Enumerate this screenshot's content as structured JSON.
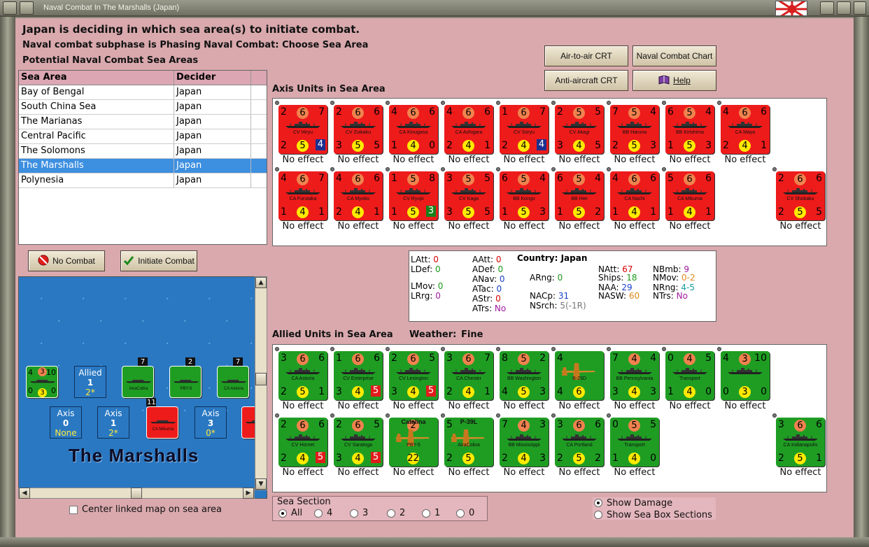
{
  "window": {
    "title": "Naval Combat In The Marshalls (Japan)"
  },
  "header": {
    "line1": "Japan is deciding in which sea area(s) to initiate combat.",
    "line2": "Naval combat subphase is Phasing Naval Combat: Choose Sea Area",
    "line3": "Potential Naval Combat Sea Areas"
  },
  "buttons": {
    "air_to_air": "Air-to-air CRT",
    "naval_chart": "Naval Combat Chart",
    "anti_aircraft": "Anti-aircraft CRT",
    "help": "Help",
    "no_combat": "No Combat",
    "initiate_combat": "Initiate Combat"
  },
  "sea_table": {
    "col_area": "Sea Area",
    "col_decider": "Decider",
    "rows": [
      {
        "area": "Bay of Bengal",
        "decider": "Japan"
      },
      {
        "area": "South China Sea",
        "decider": "Japan"
      },
      {
        "area": "The Marianas",
        "decider": "Japan"
      },
      {
        "area": "Central Pacific",
        "decider": "Japan"
      },
      {
        "area": "The Solomons",
        "decider": "Japan"
      },
      {
        "area": "The Marshalls",
        "decider": "Japan",
        "selected": true
      },
      {
        "area": "Polynesia",
        "decider": "Japan"
      }
    ]
  },
  "axis_section": {
    "title": "Axis Units in Sea Area",
    "status_text": "No effect",
    "units": [
      {
        "name": "CV Hiryu",
        "tl": "2",
        "tc": "6",
        "tr": "7",
        "bl": "2",
        "bc": "5",
        "br": "4",
        "br_box": "navy"
      },
      {
        "name": "CV Zuikaku",
        "tl": "2",
        "tc": "6",
        "tr": "6",
        "bl": "3",
        "bc": "5",
        "br": "5"
      },
      {
        "name": "CA Kinugasa",
        "tl": "4",
        "tc": "6",
        "tr": "6",
        "bl": "1",
        "bc": "4",
        "br": "0"
      },
      {
        "name": "CA Ashigara",
        "tl": "4",
        "tc": "6",
        "tr": "6",
        "bl": "2",
        "bc": "4",
        "br": "1"
      },
      {
        "name": "CV Soryu",
        "tl": "1",
        "tc": "6",
        "tr": "7",
        "bl": "2",
        "bc": "4",
        "br": "4",
        "br_box": "navy"
      },
      {
        "name": "CV Akagi",
        "tl": "2",
        "tc": "5",
        "tr": "5",
        "bl": "3",
        "bc": "4",
        "br": "5"
      },
      {
        "name": "BB Haruna",
        "tl": "7",
        "tc": "5",
        "tr": "4",
        "bl": "2",
        "bc": "5",
        "br": "3"
      },
      {
        "name": "BB Kirishima",
        "tl": "6",
        "tc": "5",
        "tr": "4",
        "bl": "1",
        "bc": "5",
        "br": "3"
      },
      {
        "name": "CA Maya",
        "tl": "4",
        "tc": "6",
        "tr": "6",
        "bl": "2",
        "bc": "4",
        "br": "1"
      },
      {
        "name": "CV Shokaku",
        "tl": "2",
        "tc": "6",
        "tr": "6",
        "bl": "2",
        "bc": "5",
        "br": "5"
      },
      {
        "name": "CA Furutaka",
        "tl": "4",
        "tc": "6",
        "tr": "7",
        "bl": "1",
        "bc": "4",
        "br": "1"
      },
      {
        "name": "CA Myoko",
        "tl": "4",
        "tc": "6",
        "tr": "6",
        "bl": "2",
        "bc": "4",
        "br": "1"
      },
      {
        "name": "CV Ryujo",
        "tl": "1",
        "tc": "5",
        "tr": "8",
        "bl": "1",
        "bc": "5",
        "br": "3",
        "br_box": "green"
      },
      {
        "name": "CV Kaga",
        "tl": "3",
        "tc": "5",
        "tr": "5",
        "bl": "3",
        "bc": "5",
        "br": "5"
      },
      {
        "name": "BB Kongo",
        "tl": "6",
        "tc": "5",
        "tr": "4",
        "bl": "1",
        "bc": "5",
        "br": "3"
      },
      {
        "name": "BB Hiei",
        "tl": "6",
        "tc": "5",
        "tr": "4",
        "bl": "1",
        "bc": "5",
        "br": "2"
      },
      {
        "name": "CA Nachi",
        "tl": "4",
        "tc": "6",
        "tr": "6",
        "bl": "1",
        "bc": "4",
        "br": "1"
      },
      {
        "name": "CA Mikuma",
        "tl": "5",
        "tc": "6",
        "tr": "6",
        "bl": "1",
        "bc": "4",
        "br": "1"
      }
    ]
  },
  "stats": {
    "country_label": "Country: Japan",
    "items": [
      {
        "k": "LAtt:",
        "v": "0",
        "col": "#d40000"
      },
      {
        "k": "LDef:",
        "v": "0",
        "col": "#1a9a1a"
      },
      {
        "k": "LMov:",
        "v": "0",
        "col": "#1a9a1a"
      },
      {
        "k": "LRrg:",
        "v": "0",
        "col": "#a01aa0"
      },
      {
        "k": "AAtt:",
        "v": "0",
        "col": "#d40000"
      },
      {
        "k": "ADef:",
        "v": "0",
        "col": "#1a9a1a"
      },
      {
        "k": "ANav:",
        "v": "0",
        "col": "#1a40c8"
      },
      {
        "k": "ATac:",
        "v": "0",
        "col": "#1a40c8"
      },
      {
        "k": "AStr:",
        "v": "0",
        "col": "#d40000"
      },
      {
        "k": "ATrs:",
        "v": "No",
        "col": "#a01aa0"
      },
      {
        "k": "ARng:",
        "v": "0",
        "col": "#1a9a1a"
      },
      {
        "k": "NACp:",
        "v": "31",
        "col": "#1a40c8"
      },
      {
        "k": "NSrch:",
        "v": "5(-1R)",
        "col": "#777"
      },
      {
        "k": "NAtt:",
        "v": "67",
        "col": "#d40000"
      },
      {
        "k": "Ships:",
        "v": "18",
        "col": "#1a9a1a"
      },
      {
        "k": "NAA:",
        "v": "29",
        "col": "#1a40c8"
      },
      {
        "k": "NASW:",
        "v": "60",
        "col": "#e08a1a"
      },
      {
        "k": "NBmb:",
        "v": "9",
        "col": "#a01aa0"
      },
      {
        "k": "NMov:",
        "v": "0-2",
        "col": "#e08a1a"
      },
      {
        "k": "NRng:",
        "v": "4-5",
        "col": "#1a9a9a"
      },
      {
        "k": "NTrs:",
        "v": "No",
        "col": "#a01aa0"
      }
    ]
  },
  "allied_section": {
    "title": "Allied Units in Sea Area",
    "weather_label": "Weather:",
    "weather": "Fine",
    "status_text": "No effect",
    "units": [
      {
        "name": "CA Astoria",
        "tl": "3",
        "tc": "6",
        "tr": "6",
        "bl": "2",
        "bc": "5",
        "br": "1"
      },
      {
        "name": "CV Enterprise",
        "tl": "1",
        "tc": "6",
        "tr": "6",
        "bl": "3",
        "bc": "4",
        "br": "5",
        "br_box": "red"
      },
      {
        "name": "CV Lexington",
        "tl": "2",
        "tc": "6",
        "tr": "5",
        "bl": "3",
        "bc": "4",
        "br": "5",
        "br_box": "red"
      },
      {
        "name": "CA Chester",
        "tl": "3",
        "tc": "6",
        "tr": "7",
        "bl": "2",
        "bc": "4",
        "br": "1"
      },
      {
        "name": "BB Washington",
        "tl": "8",
        "tc": "5",
        "tr": "2",
        "bl": "4",
        "bc": "5",
        "br": "3"
      },
      {
        "name": "B-25D",
        "air": true,
        "tl": "4",
        "tc": "",
        "tr": "",
        "bl": "4",
        "bc": "6",
        "br": ""
      },
      {
        "name": "BB Pennsylvania",
        "tl": "7",
        "tc": "4",
        "tr": "4",
        "bl": "3",
        "bc": "4",
        "br": "3"
      },
      {
        "name": "Transport",
        "tl": "0",
        "tc": "4",
        "tr": "5",
        "bl": "1",
        "bc": "4",
        "br": "0"
      },
      {
        "name": "",
        "tl": "4",
        "tc": "3",
        "tr": "10",
        "bl": "0",
        "bc": "3",
        "br": "0",
        "tl_box": "white"
      },
      {
        "name": "CA Indianapolis",
        "tl": "3",
        "tc": "6",
        "tr": "6",
        "bl": "2",
        "bc": "5",
        "br": "1"
      },
      {
        "name": "CV Hornet",
        "tl": "2",
        "tc": "6",
        "tr": "6",
        "bl": "2",
        "bc": "4",
        "br": "5",
        "br_box": "red"
      },
      {
        "name": "CV Saratoga",
        "tl": "2",
        "tc": "6",
        "tr": "5",
        "bl": "3",
        "bc": "4",
        "br": "5",
        "br_box": "red"
      },
      {
        "name": "PBY-5",
        "air": true,
        "title": "Catalina",
        "tl": "",
        "tc": "2",
        "tr": "",
        "bl": "",
        "bc": "22",
        "br": ""
      },
      {
        "name": "AiraCobra",
        "air": true,
        "title": "P-39L",
        "tl": "5",
        "tc": "",
        "tr": "",
        "bl": "2",
        "bc": "5",
        "br": ""
      },
      {
        "name": "BB Mississippi",
        "tl": "7",
        "tc": "4",
        "tr": "3",
        "bl": "2",
        "bc": "4",
        "br": "3"
      },
      {
        "name": "CA Portland",
        "tl": "3",
        "tc": "6",
        "tr": "6",
        "bl": "2",
        "bc": "5",
        "br": "2"
      },
      {
        "name": "Transport",
        "tl": "0",
        "tc": "5",
        "tr": "5",
        "bl": "1",
        "bc": "4",
        "br": "0"
      }
    ]
  },
  "map": {
    "sea_name": "The Marshalls",
    "allied_box": {
      "title": "Allied",
      "value": "1",
      "sub": "2*"
    },
    "axis_boxes": [
      {
        "title": "Axis",
        "value": "0",
        "sub": "None"
      },
      {
        "title": "Axis",
        "value": "1",
        "sub": "2*"
      },
      {
        "title": "Axis",
        "value": "3",
        "sub": "0*"
      }
    ],
    "stack_counts": [
      "7",
      "2",
      "7",
      "11"
    ],
    "mini": [
      {
        "name": "P-39L",
        "sub": "AiraCobra"
      },
      {
        "name": "Catalina",
        "sub": "PBY-5"
      },
      {
        "name": "CA Astoria"
      },
      {
        "name": "CA Mikuma"
      }
    ],
    "left_counter": {
      "a": "4",
      "b": "3",
      "c": "10",
      "d": "0",
      "e": "3",
      "f": "0"
    }
  },
  "center_linked_label": "Center linked map on sea area",
  "sea_section": {
    "title": "Sea Section",
    "options": [
      "All",
      "4",
      "3",
      "2",
      "1",
      "0"
    ],
    "selected": "All"
  },
  "display_options": [
    {
      "label": "Show Damage",
      "selected": true
    },
    {
      "label": "Show Sea Box Sections",
      "selected": false
    }
  ],
  "colors": {
    "background": "#d9a9ad",
    "axis_counter": "#ee1b1b",
    "allied_counter": "#1f9d23",
    "selected_row": "#3d8fe0",
    "sea": "#2a78c2"
  }
}
